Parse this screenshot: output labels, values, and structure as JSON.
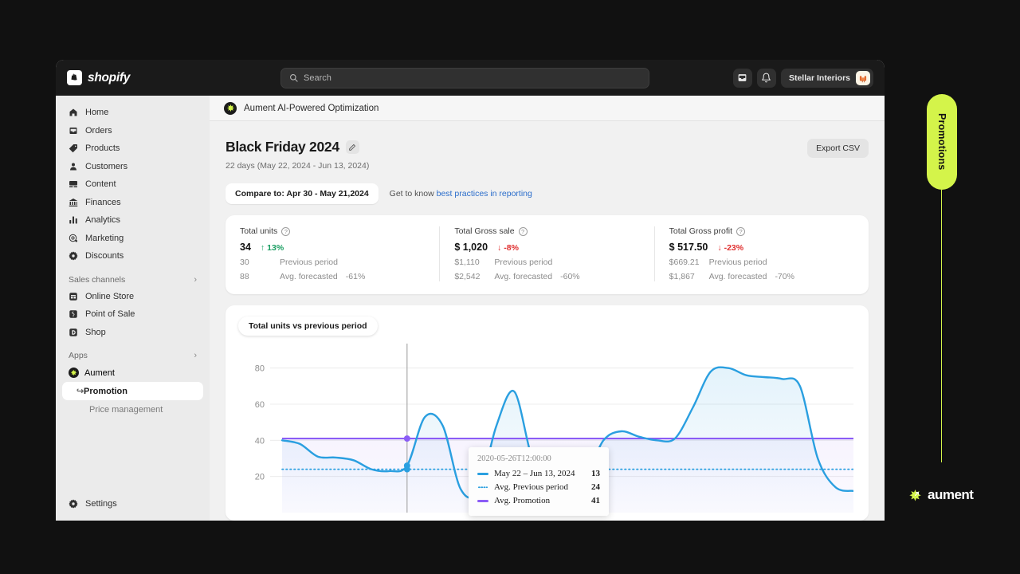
{
  "topbar": {
    "brand_name": "shopify",
    "brand_mark": "shopify-bag-icon",
    "search_placeholder": "Search",
    "search_value": "",
    "inbox_icon": "inbox-icon",
    "bell_icon": "notification-bell-icon",
    "user_name": "Stellar Interiors",
    "avatar_icon": "armchair-avatar"
  },
  "sidebar": {
    "items": [
      {
        "label": "Home",
        "icon": "home-icon"
      },
      {
        "label": "Orders",
        "icon": "orders-inbox-icon"
      },
      {
        "label": "Products",
        "icon": "products-tag-icon"
      },
      {
        "label": "Customers",
        "icon": "customers-person-icon"
      },
      {
        "label": "Content",
        "icon": "content-media-icon"
      },
      {
        "label": "Finances",
        "icon": "finances-bank-icon"
      },
      {
        "label": "Analytics",
        "icon": "analytics-bars-icon"
      },
      {
        "label": "Marketing",
        "icon": "marketing-target-icon"
      },
      {
        "label": "Discounts",
        "icon": "discounts-gear-icon"
      }
    ],
    "sections": [
      {
        "label": "Sales channels",
        "chevron": "chevron-right-icon",
        "items": [
          {
            "label": "Online Store",
            "icon": "online-store-icon"
          },
          {
            "label": "Point of Sale",
            "icon": "point-of-sale-icon"
          },
          {
            "label": "Shop",
            "icon": "shop-icon"
          }
        ]
      },
      {
        "label": "Apps",
        "chevron": "chevron-right-icon",
        "items": [
          {
            "label": "Aument",
            "icon": "aument-logo-icon"
          },
          {
            "label": "Promotion",
            "icon": "elbow-arrow-icon",
            "selected": true
          },
          {
            "label": "Price management",
            "icon": "none"
          }
        ]
      }
    ],
    "settings": {
      "label": "Settings",
      "icon": "settings-gear-icon"
    }
  },
  "appbar": {
    "logo": "aument-logo-icon",
    "title": "Aument AI-Powered Optimization"
  },
  "page": {
    "title": "Black Friday 2024",
    "edit_icon": "pencil-icon",
    "subtitle": "22 days (May 22, 2024 - Jun 13, 2024)",
    "export_label": "Export CSV",
    "compare_label": "Compare to: Apr 30 - May 21,2024",
    "hint_prefix": "Get to know ",
    "hint_link": "best practices in reporting"
  },
  "kpis": [
    {
      "label": "Total units",
      "help_icon": "question-mark-icon",
      "value": "34",
      "delta": "13%",
      "delta_arrow": "↑",
      "delta_dir": "up",
      "prev_value": "30",
      "prev_label": "Previous period",
      "forecast_value": "88",
      "forecast_label": "Avg. forecasted",
      "forecast_delta": "-61%"
    },
    {
      "label": "Total Gross sale",
      "help_icon": "question-mark-icon",
      "value": "$ 1,020",
      "delta": "-8%",
      "delta_arrow": "↓",
      "delta_dir": "down",
      "prev_value": "$1,110",
      "prev_label": "Previous period",
      "forecast_value": "$2,542",
      "forecast_label": "Avg. forecasted",
      "forecast_delta": "-60%"
    },
    {
      "label": "Total Gross profit",
      "help_icon": "question-mark-icon",
      "value": "$ 517.50",
      "delta": "-23%",
      "delta_arrow": "↓",
      "delta_dir": "down",
      "prev_value": "$669.21",
      "prev_label": "Previous period",
      "forecast_value": "$1,867",
      "forecast_label": "Avg. forecasted",
      "forecast_delta": "-70%"
    }
  ],
  "chart_panel": {
    "chip_label": "Total units vs previous period"
  },
  "tooltip": {
    "timestamp": "2020-05-26T12:00:00",
    "rows": [
      {
        "swatch": "solid",
        "color": "#2a9fe0",
        "name": "May 22 – Jun 13, 2024",
        "value": "13"
      },
      {
        "swatch": "dotted",
        "color": "#2a9fe0",
        "name": "Avg. Previous period",
        "value": "24"
      },
      {
        "swatch": "solid",
        "color": "#8b5cf6",
        "name": "Avg. Promotion",
        "value": "41"
      }
    ]
  },
  "rail": {
    "promo_label": "Promotions",
    "promo_color": "#d4f44a",
    "wordmark": "aument",
    "logo_icon": "aument-logo-icon"
  },
  "chart_data": {
    "type": "line",
    "title": "Total units vs previous period",
    "xlabel": "",
    "ylabel": "",
    "ylim": [
      0,
      90
    ],
    "yticks": [
      20,
      40,
      60,
      80
    ],
    "grid": true,
    "legend_position": "tooltip",
    "cursor_x_index": 7,
    "series": [
      {
        "name": "May 22 – Jun 13, 2024",
        "color": "#2a9fe0",
        "style": "solid",
        "area_fill": true,
        "values": [
          40,
          38,
          31,
          30.5,
          29,
          24,
          23,
          26,
          53,
          48,
          13,
          12,
          48,
          67,
          30,
          13,
          13,
          20,
          40,
          45,
          42,
          40,
          41,
          58,
          78,
          80,
          76,
          75,
          74,
          70,
          30,
          14,
          12
        ]
      },
      {
        "name": "Avg. Previous period",
        "color": "#2a9fe0",
        "style": "dotted",
        "constant": 24
      },
      {
        "name": "Avg. Promotion",
        "color": "#8b5cf6",
        "style": "solid",
        "constant": 41
      }
    ],
    "tooltip_point": {
      "x_label": "2020-05-26T12:00:00",
      "values": {
        "May 22 – Jun 13, 2024": 13,
        "Avg. Previous period": 24,
        "Avg. Promotion": 41
      }
    }
  }
}
